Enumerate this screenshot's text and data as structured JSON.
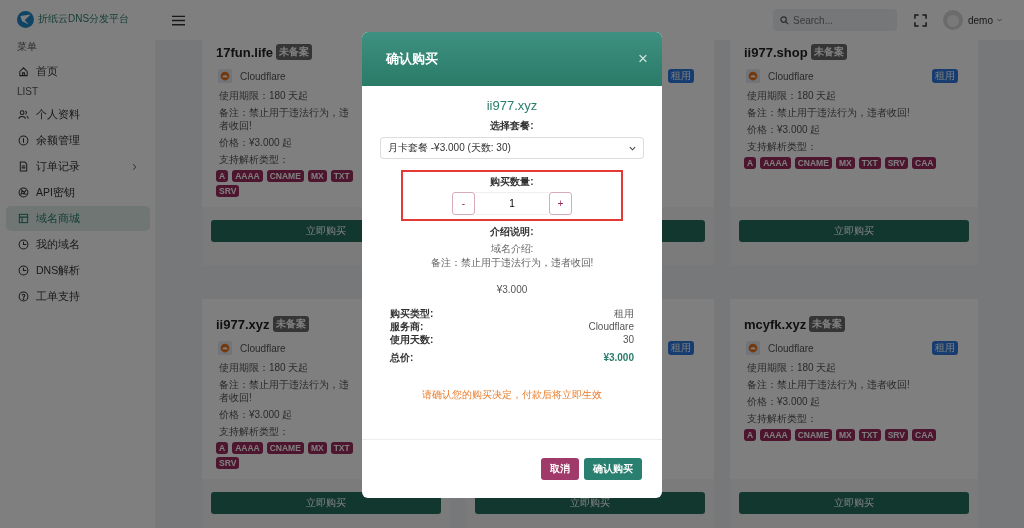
{
  "brand": {
    "name": "折纸云DNS分发平台"
  },
  "header": {
    "search_placeholder": "Search...",
    "user": "demo"
  },
  "sidebar": {
    "sections": [
      {
        "label": "菜单",
        "items": [
          {
            "label": "首页",
            "selected": false,
            "has_submenu": false
          }
        ]
      },
      {
        "label": "LIST",
        "items": [
          {
            "label": "个人资料",
            "selected": false,
            "has_submenu": false
          },
          {
            "label": "余额管理",
            "selected": false,
            "has_submenu": false
          },
          {
            "label": "订单记录",
            "selected": false,
            "has_submenu": true
          },
          {
            "label": "API密钥",
            "selected": false,
            "has_submenu": false
          },
          {
            "label": "域名商城",
            "selected": true,
            "has_submenu": false
          },
          {
            "label": "我的域名",
            "selected": false,
            "has_submenu": false
          },
          {
            "label": "DNS解析",
            "selected": false,
            "has_submenu": false
          },
          {
            "label": "工单支持",
            "selected": false,
            "has_submenu": false
          }
        ]
      }
    ]
  },
  "cards": [
    {
      "domain": "17fun.life",
      "badge": "未备案",
      "provider": "Cloudflare",
      "lines": [
        "使用期限：180 天起",
        "备注：禁止用于违法行为，违者收回!",
        "价格：¥3.000 起",
        "支持解析类型："
      ],
      "tags": [
        "A",
        "AAAA",
        "CNAME",
        "MX",
        "TXT",
        "SRV"
      ],
      "button": "立即购买"
    },
    {
      "rent_badge": "租用"
    },
    {
      "domain": "ii977.shop",
      "badge": "未备案",
      "provider": "Cloudflare",
      "rent_badge": "租用",
      "lines": [
        "使用期限：180 天起",
        "备注：禁止用于违法行为，违者收回!",
        "价格：¥3.000 起",
        "支持解析类型："
      ],
      "tags": [
        "A",
        "AAAA",
        "CNAME",
        "MX",
        "TXT",
        "SRV",
        "CAA"
      ],
      "button": "立即购买"
    },
    {
      "domain": "ii977.xyz",
      "badge": "未备案",
      "provider": "Cloudflare",
      "lines": [
        "使用期限：180 天起",
        "备注：禁止用于违法行为，违者收回!",
        "价格：¥3.000 起",
        "支持解析类型："
      ],
      "tags": [
        "A",
        "AAAA",
        "CNAME",
        "MX",
        "TXT",
        "SRV"
      ],
      "button": "立即购买"
    },
    {
      "rent_badge": "租用",
      "button": "立即购买"
    },
    {
      "domain": "mcyfk.xyz",
      "badge": "未备案",
      "provider": "Cloudflare",
      "rent_badge": "租用",
      "lines": [
        "使用期限：180 天起",
        "备注：禁止用于违法行为，违者收回!",
        "价格：¥3.000 起",
        "支持解析类型："
      ],
      "tags": [
        "A",
        "AAAA",
        "CNAME",
        "MX",
        "TXT",
        "SRV",
        "CAA"
      ],
      "button": "立即购买"
    }
  ],
  "modal": {
    "title": "确认购买",
    "close": "×",
    "domain": "ii977.xyz",
    "plan_label": "选择套餐:",
    "plan_value": "月卡套餐 -¥3.000 (天数: 30)",
    "quantity_label": "购买数量:",
    "quantity": "1",
    "minus": "-",
    "plus": "+",
    "highlighted": true,
    "intro_label": "介绍说明:",
    "intro_lines": [
      "域名介绍:",
      "备注：禁止用于违法行为，违者收回!"
    ],
    "price": "¥3.000",
    "summary": [
      {
        "label": "购买类型:",
        "value": "租用",
        "kind": "plain"
      },
      {
        "label": "服务商:",
        "value": "Cloudflare",
        "kind": "plain"
      },
      {
        "label": "使用天数:",
        "value": "30",
        "kind": "plain"
      },
      {
        "label": "总价:",
        "value": "¥3.000",
        "kind": "total"
      }
    ],
    "warning": "请确认您的购买决定，付款后将立即生效",
    "cancel": "取消",
    "confirm": "确认购买"
  }
}
